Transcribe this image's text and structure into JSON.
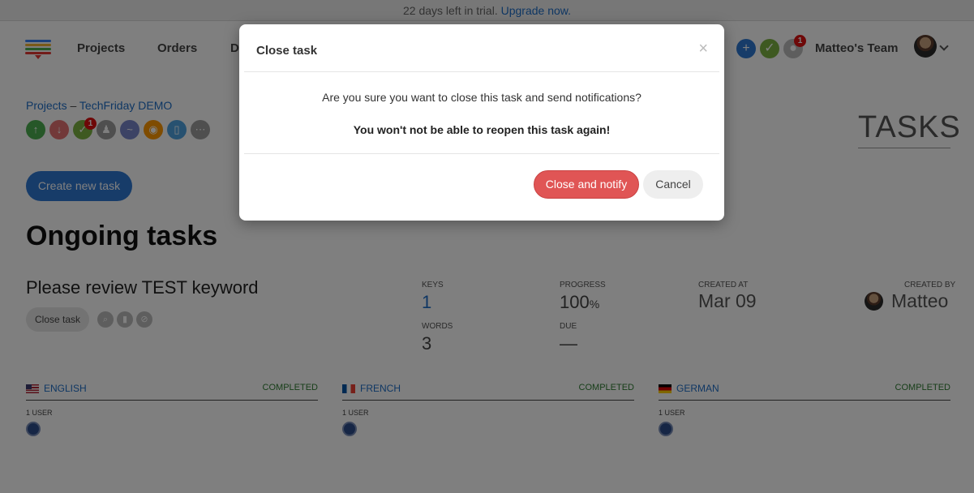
{
  "trial": {
    "text": "22 days left in trial.",
    "link": "Upgrade now."
  },
  "nav": {
    "items": [
      "Projects",
      "Orders",
      "D"
    ],
    "notification_count": "1",
    "team": "Matteo's Team"
  },
  "breadcrumb": {
    "root": "Projects",
    "sep": "–",
    "project": "TechFriday DEMO"
  },
  "toolbar_badge": "1",
  "page_heading": "TASKS",
  "create_button": "Create new task",
  "section_title": "Ongoing tasks",
  "task": {
    "title": "Please review TEST keyword",
    "close_button": "Close task",
    "keys_label": "KEYS",
    "keys_value": "1",
    "progress_label": "PROGRESS",
    "progress_value": "100",
    "progress_unit": "%",
    "created_at_label": "CREATED AT",
    "created_at_value": "Mar 09",
    "created_by_label": "CREATED BY",
    "created_by_value": "Matteo",
    "words_label": "WORDS",
    "words_value": "3",
    "due_label": "DUE",
    "due_value": "—"
  },
  "languages": [
    {
      "name": "ENGLISH",
      "status": "COMPLETED",
      "users": "1 USER"
    },
    {
      "name": "FRENCH",
      "status": "COMPLETED",
      "users": "1 USER"
    },
    {
      "name": "GERMAN",
      "status": "COMPLETED",
      "users": "1 USER"
    }
  ],
  "modal": {
    "title": "Close task",
    "close_symbol": "×",
    "message": "Are you sure you want to close this task and send notifications?",
    "warning": "You won't not be able to reopen this task again!",
    "confirm": "Close and notify",
    "cancel": "Cancel"
  },
  "colors": {
    "accent": "#2f79d3",
    "danger": "#e05555",
    "success": "#2e7d32"
  }
}
